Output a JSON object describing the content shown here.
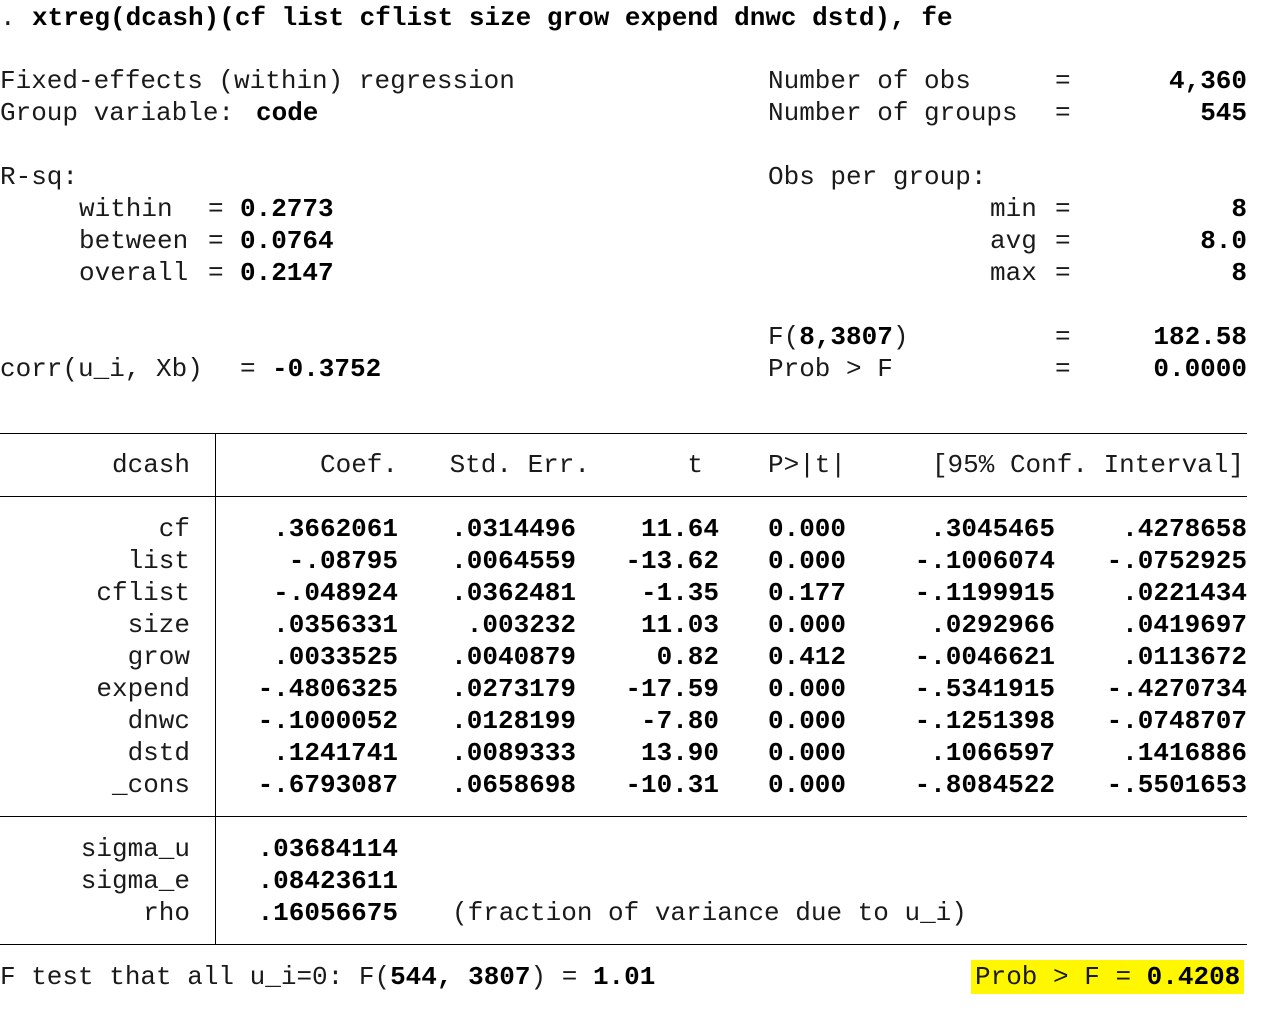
{
  "command": {
    "prompt": ".",
    "text": "xtreg(dcash)(cf list cflist size grow expend dnwc dstd), fe"
  },
  "header": {
    "title": "Fixed-effects (within) regression",
    "group_label": "Group variable:",
    "group_var": "code",
    "nobs_label": "Number of obs",
    "nobs": "4,360",
    "ngroups_label": "Number of groups",
    "ngroups": "545",
    "eq": "=",
    "rsq_label": "R-sq:",
    "within_label": "within",
    "within_val": "0.2773",
    "between_label": "between",
    "between_val": "0.0764",
    "overall_label": "overall",
    "overall_val": "0.2147",
    "obs_per_group_label": "Obs per group:",
    "min_label": "min",
    "min_val": "8",
    "avg_label": "avg",
    "avg_val": "8.0",
    "max_label": "max",
    "max_val": "8",
    "f_label_prefix": "F(",
    "f_df": "8,3807",
    "f_label_suffix": ")",
    "f_val": "182.58",
    "corr_label": "corr(u_i, Xb)",
    "corr_val": "-0.3752",
    "probf_label": "Prob > F",
    "probf_val": "0.0000"
  },
  "table": {
    "depvar": "dcash",
    "columns": [
      "Coef.",
      "Std. Err.",
      "t",
      "P>|t|",
      "[95% Conf. Interval]"
    ],
    "rows": [
      {
        "var": "cf",
        "coef": ".3662061",
        "se": ".0314496",
        "t": "11.64",
        "p": "0.000",
        "lo": ".3045465",
        "hi": ".4278658"
      },
      {
        "var": "list",
        "coef": "-.08795",
        "se": ".0064559",
        "t": "-13.62",
        "p": "0.000",
        "lo": "-.1006074",
        "hi": "-.0752925"
      },
      {
        "var": "cflist",
        "coef": "-.048924",
        "se": ".0362481",
        "t": "-1.35",
        "p": "0.177",
        "lo": "-.1199915",
        "hi": ".0221434"
      },
      {
        "var": "size",
        "coef": ".0356331",
        "se": ".003232",
        "t": "11.03",
        "p": "0.000",
        "lo": ".0292966",
        "hi": ".0419697"
      },
      {
        "var": "grow",
        "coef": ".0033525",
        "se": ".0040879",
        "t": "0.82",
        "p": "0.412",
        "lo": "-.0046621",
        "hi": ".0113672"
      },
      {
        "var": "expend",
        "coef": "-.4806325",
        "se": ".0273179",
        "t": "-17.59",
        "p": "0.000",
        "lo": "-.5341915",
        "hi": "-.4270734"
      },
      {
        "var": "dnwc",
        "coef": "-.1000052",
        "se": ".0128199",
        "t": "-7.80",
        "p": "0.000",
        "lo": "-.1251398",
        "hi": "-.0748707"
      },
      {
        "var": "dstd",
        "coef": ".1241741",
        "se": ".0089333",
        "t": "13.90",
        "p": "0.000",
        "lo": ".1066597",
        "hi": ".1416886"
      },
      {
        "var": "_cons",
        "coef": "-.6793087",
        "se": ".0658698",
        "t": "-10.31",
        "p": "0.000",
        "lo": "-.8084522",
        "hi": "-.5501653"
      }
    ],
    "sigma_u_label": "sigma_u",
    "sigma_u": ".03684114",
    "sigma_e_label": "sigma_e",
    "sigma_e": ".08423611",
    "rho_label": "rho",
    "rho": ".16056675",
    "rho_note": "(fraction of variance due to u_i)"
  },
  "ftest": {
    "prefix": "F test that all u_i=0: F(",
    "df": "544, 3807",
    "suffix": ")",
    "eq": "=",
    "val": "1.01",
    "prob_label": "Prob > F",
    "prob_eq": "=",
    "prob_val": "0.4208",
    "highlight_color": "#fff700"
  }
}
